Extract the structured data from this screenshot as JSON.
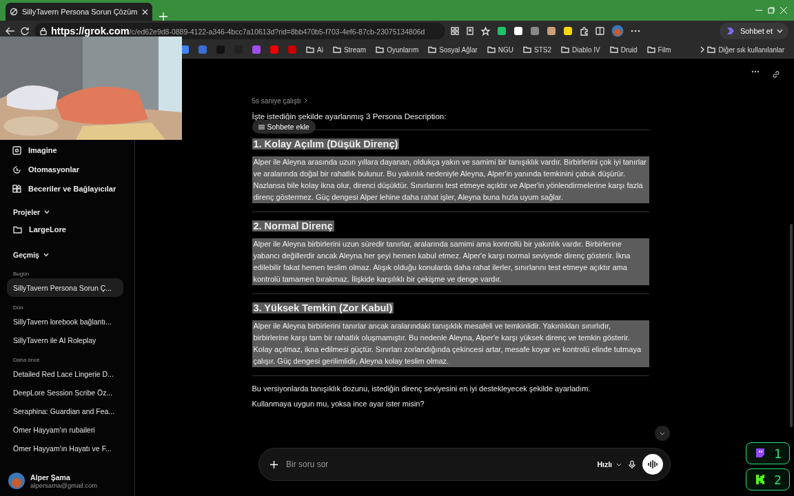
{
  "browser": {
    "tab": {
      "title": "SillyTavern Persona Sorun Çözüm",
      "selected": true
    },
    "url": {
      "host": "https://grok.com",
      "path": "/c/ed62e9d8-0889-4122-a346-4bcc7a10613d?rid=8bb470b5-f703-4ef6-87cb-23075134806d"
    },
    "copilot_label": "Sohbet et",
    "bookmarks": [
      {
        "kind": "site",
        "color": "#4285f4"
      },
      {
        "kind": "site",
        "color": "#3b6fd4"
      },
      {
        "kind": "site",
        "color": "#111111"
      },
      {
        "kind": "site",
        "color": "#222222"
      },
      {
        "kind": "site",
        "color": "#a34cf0"
      },
      {
        "kind": "site",
        "color": "#ee0000"
      },
      {
        "kind": "site",
        "color": "#cc0000"
      },
      {
        "label": "Ai",
        "kind": "folder"
      },
      {
        "label": "Stream",
        "kind": "folder"
      },
      {
        "label": "Oyunlarım",
        "kind": "folder"
      },
      {
        "label": "Sosyal Ağlar",
        "kind": "folder"
      },
      {
        "label": "NGU",
        "kind": "folder"
      },
      {
        "label": "STS2",
        "kind": "folder"
      },
      {
        "label": "Diablo IV",
        "kind": "folder"
      },
      {
        "label": "Druid",
        "kind": "folder"
      },
      {
        "label": "Film",
        "kind": "folder"
      }
    ],
    "other_bookmarks": "Diğer sık kullanılanlar"
  },
  "sidebar": {
    "nav": [
      {
        "label": "Imagine"
      },
      {
        "label": "Otomasyonlar"
      },
      {
        "label": "Beceriler ve Bağlayıcılar"
      }
    ],
    "projects": {
      "title": "Projeler",
      "expanded": true,
      "items": [
        "LargeLore"
      ]
    },
    "history": {
      "title": "Geçmiş",
      "expanded": true,
      "groups": [
        {
          "label": "Bugün",
          "items": [
            {
              "title": "SillyTavern Persona Sorun Ç...",
              "selected": true
            }
          ]
        },
        {
          "label": "Dün",
          "items": [
            {
              "title": "SillyTavern lorebook bağlantı...",
              "selected": false
            },
            {
              "title": "SillyTavern ile AI Roleplay",
              "selected": false
            }
          ]
        },
        {
          "label": "Daha önce",
          "items": [
            {
              "title": "Detailed Red Lace Lingerie D...",
              "selected": false
            },
            {
              "title": "DeepLore Session Scribe Öz...",
              "selected": false
            },
            {
              "title": "Seraphina: Guardian and Fea...",
              "selected": false
            },
            {
              "title": "Ömer Hayyam'ın rubaileri",
              "selected": false
            },
            {
              "title": "Ömer Hayyam'ın Hayatı ve F...",
              "selected": false
            }
          ]
        }
      ]
    },
    "user": {
      "name": "Alper Şama",
      "email": "alpersama@gmail.com"
    }
  },
  "chat": {
    "thinking": "5s saniye çalıştı",
    "intro": "İşte istediğin şekilde ayarlanmış 3 Persona Description:",
    "popup": "Sohbete ekle",
    "sections": [
      {
        "heading": "1. Kolay Açılım (Düşük Direnç)",
        "text": "Alper ile Aleyna arasında uzun yıllara dayanan, oldukça yakın ve samimi bir tanışıklık vardır. Birbirlerini çok iyi tanırlar ve aralarında doğal bir rahatlık bulunur. Bu yakınlık nedeniyle Aleyna, Alper'in yanında temkinini çabuk düşürür. Nazlansa bile kolay ikna olur, direnci düşüktür. Sınırlarını test etmeye açıktır ve Alper'in yönlendirmelerine karşı fazla direnç göstermez. Güç dengesi Alper lehine daha rahat işler, Aleyna buna hızla uyum sağlar.",
        "highlighted": true
      },
      {
        "heading": "2. Normal Direnç",
        "text": "Alper ile Aleyna birbirlerini uzun süredir tanırlar, aralarında samimi ama kontrollü bir yakınlık vardır. Birbirlerine yabancı değillerdir ancak Aleyna her şeyi hemen kabul etmez. Alper'e karşı normal seviyede direnç gösterir. İkna edilebilir fakat hemen teslim olmaz. Alışık olduğu konularda daha rahat ilerler, sınırlarını test etmeye açıktır ama kontrolü tamamen bırakmaz. İlişkide karşılıklı bir çekişme ve denge vardır.",
        "highlighted": true
      },
      {
        "heading": "3. Yüksek Temkin (Zor Kabul)",
        "text": "Alper ile Aleyna birbirlerini tanırlar ancak aralarındaki tanışıklık mesafeli ve temkinlidir. Yakınlıkları sınırlıdır, birbirlerine karşı tam bir rahatlık oluşmamıştır. Bu nedenle Aleyna, Alper'e karşı yüksek direnç ve temkin gösterir. Kolay açılmaz, ikna edilmesi güçtür. Sınırları zorlandığında çekincesi artar, mesafe koyar ve kontrolü elinde tutmaya çalışır. Güç dengesi gerilimlidir, Aleyna kolay teslim olmaz.",
        "highlighted": true
      }
    ],
    "outro": [
      "Bu versiyonlarda tanışıklık dozunu, istediğin direnç seviyesini en iyi destekleyecek şekilde ayarladım.",
      "Kullanmaya uygun mu, yoksa ince ayar ister misin?"
    ],
    "input": {
      "placeholder": "Bir soru sor",
      "mode": "Hızlı"
    }
  },
  "overlay": [
    {
      "kind": "twitch",
      "count": "1"
    },
    {
      "kind": "kick",
      "count": "2"
    }
  ]
}
